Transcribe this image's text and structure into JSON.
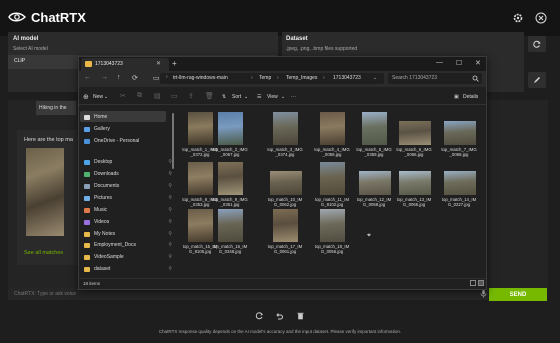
{
  "app": {
    "title": "ChatRTX"
  },
  "model": {
    "label": "AI model",
    "sublabel": "Select AI model",
    "selected": "CLIP"
  },
  "dataset": {
    "label": "Dataset",
    "sublabel": ".jpeg, .png, .bmp files supported"
  },
  "chat": {
    "user_message": "Hiking in the",
    "bot_message": "Here are the top ma",
    "see_all": "See all matches"
  },
  "input": {
    "placeholder": "ChatRTX: Type or ask voice",
    "send_label": "SEND"
  },
  "footer": {
    "text": "ChatRTX response quality depends on the AI model's accuracy and the input dataset. Please verify important information."
  },
  "explorer": {
    "tab_title": "1713043723",
    "breadcrumbs": [
      "trt-llm-rag-windows-main",
      "Temp",
      "Temp_Images",
      "1713043723"
    ],
    "search_placeholder": "Search 1713043723",
    "toolbar": {
      "new": "New",
      "sort": "Sort",
      "view": "View",
      "more": "···",
      "details": "Details"
    },
    "sidebar": [
      {
        "label": "Home",
        "icon": "home-icon",
        "pinned": false
      },
      {
        "label": "Gallery",
        "icon": "gallery-icon",
        "pinned": false
      },
      {
        "label": "OneDrive - Personal",
        "icon": "cloud-icon",
        "pinned": false
      },
      {
        "label": "Desktop",
        "icon": "desktop-icon",
        "pinned": true
      },
      {
        "label": "Downloads",
        "icon": "download-icon",
        "pinned": true
      },
      {
        "label": "Documents",
        "icon": "document-icon",
        "pinned": true
      },
      {
        "label": "Pictures",
        "icon": "pictures-icon",
        "pinned": true
      },
      {
        "label": "Music",
        "icon": "music-icon",
        "pinned": true
      },
      {
        "label": "Videos",
        "icon": "video-icon",
        "pinned": true
      },
      {
        "label": "My Notes",
        "icon": "folder-icon",
        "pinned": true
      },
      {
        "label": "Employment_Docs",
        "icon": "folder-icon",
        "pinned": true
      },
      {
        "label": "VideoSample",
        "icon": "folder-icon",
        "pinned": true
      },
      {
        "label": "dataset",
        "icon": "folder-icon",
        "pinned": true
      }
    ],
    "files": [
      {
        "name": "top_match_1_IMG_0372.jpg"
      },
      {
        "name": "top_match_2_IMG_0067.jpg"
      },
      {
        "name": "top_match_3_IMG_0374.jpg"
      },
      {
        "name": "top_match_4_IMG_0058.jpg"
      },
      {
        "name": "top_match_5_IMG_0359.jpg"
      },
      {
        "name": "top_match_6_IMG_0066.jpg"
      },
      {
        "name": "top_match_7_IMG_0068.jpg"
      },
      {
        "name": "top_match_8_IMG_0353.jpg"
      },
      {
        "name": "top_match_9_IMG_0351.jpg"
      },
      {
        "name": "top_match_10_IMG_0062.jpg"
      },
      {
        "name": "top_match_11_IMG_8102.jpg"
      },
      {
        "name": "top_match_12_IMG_0058.jpg"
      },
      {
        "name": "top_match_13_IMG_0066.jpg"
      },
      {
        "name": "top_match_14_IMG_0227.jpg"
      },
      {
        "name": "top_match_15_IMG_8105.jpg"
      },
      {
        "name": "top_match_16_IMG_0348.jpg"
      },
      {
        "name": "top_match_17_IMG_0061.jpg"
      },
      {
        "name": "top_match_18_IMG_0056.jpg"
      }
    ],
    "status": "18 items"
  },
  "colors": {
    "accent": "#76b900",
    "background": "#1e1e1e",
    "folder": "#e8b84a"
  }
}
